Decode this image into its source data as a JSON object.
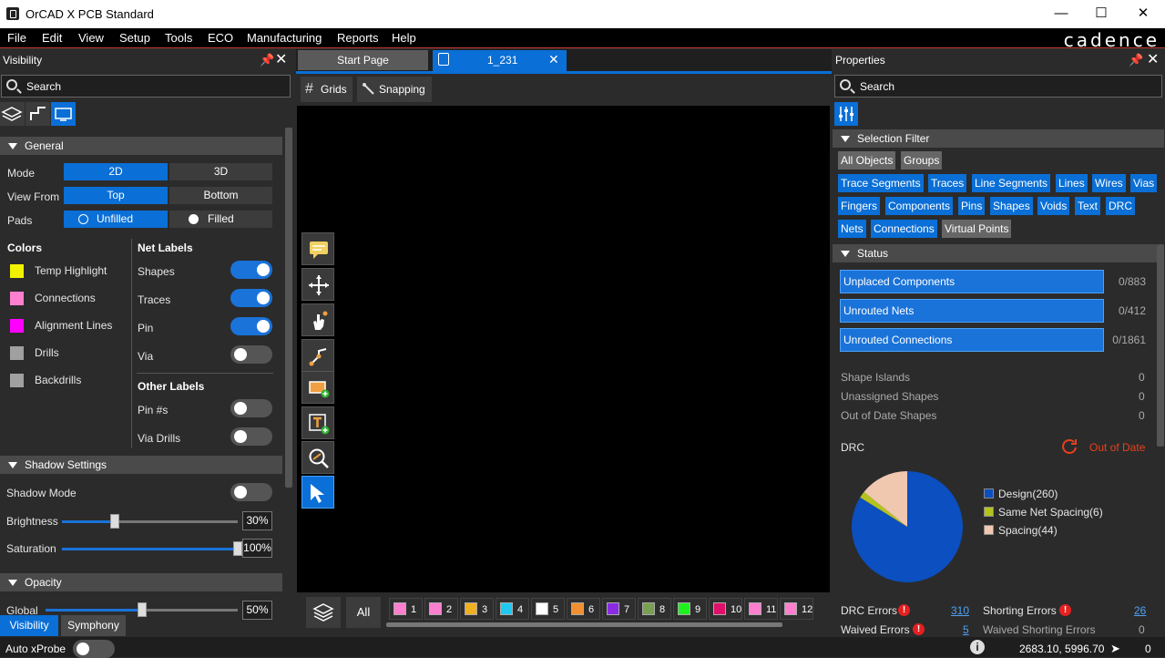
{
  "app": {
    "title": "OrCAD X PCB Standard",
    "brand": "cadence",
    "window_controls": [
      "—",
      "☐",
      "✕"
    ]
  },
  "menu": [
    "File",
    "Edit",
    "View",
    "Setup",
    "Tools",
    "ECO",
    "Manufacturing",
    "Reports",
    "Help"
  ],
  "visibility": {
    "title": "Visibility",
    "search_placeholder": "Search",
    "general": {
      "title": "General",
      "mode_label": "Mode",
      "mode_options": [
        "2D",
        "3D"
      ],
      "mode_selected": "2D",
      "view_from_label": "View From",
      "view_from_options": [
        "Top",
        "Bottom"
      ],
      "view_from_selected": "Top",
      "pads_label": "Pads",
      "pads_options": [
        "Unfilled",
        "Filled"
      ],
      "pads_selected": "Unfilled"
    },
    "colors": {
      "title": "Colors",
      "items": [
        {
          "label": "Temp Highlight",
          "color": "#f2f200"
        },
        {
          "label": "Connections",
          "color": "#ff7fcf"
        },
        {
          "label": "Alignment Lines",
          "color": "#ff00ff"
        },
        {
          "label": "Drills",
          "color": "#a0a0a0"
        },
        {
          "label": "Backdrills",
          "color": "#a0a0a0"
        }
      ]
    },
    "net_labels": {
      "title": "Net Labels",
      "items": [
        {
          "label": "Shapes",
          "on": true
        },
        {
          "label": "Traces",
          "on": true
        },
        {
          "label": "Pin",
          "on": true
        },
        {
          "label": "Via",
          "on": false
        }
      ]
    },
    "other_labels": {
      "title": "Other Labels",
      "items": [
        {
          "label": "Pin #s",
          "on": false
        },
        {
          "label": "Via Drills",
          "on": false
        }
      ]
    },
    "shadow": {
      "title": "Shadow Settings",
      "mode_label": "Shadow Mode",
      "mode_on": false,
      "brightness_label": "Brightness",
      "brightness": "30%",
      "brightness_value": 0.3,
      "saturation_label": "Saturation",
      "saturation": "100%",
      "saturation_value": 1.0
    },
    "opacity": {
      "title": "Opacity",
      "global_label": "Global",
      "global": "50%",
      "global_value": 0.5
    },
    "bottom_tabs": [
      "Visibility",
      "Symphony"
    ]
  },
  "editor": {
    "tabs": [
      "Start Page",
      "1_231"
    ],
    "active_tab": "1_231",
    "toolbar": {
      "grids": "Grids",
      "snapping": "Snapping"
    },
    "tools": [
      "comment-icon",
      "move-icon",
      "hand-icon",
      "route-icon",
      "add-shape-icon",
      "add-text-icon",
      "zoom-icon",
      "select-arrow-icon"
    ],
    "layers_all": "All",
    "layers": [
      {
        "num": "1",
        "color": "#ff7fcf"
      },
      {
        "num": "2",
        "color": "#ff7fcf"
      },
      {
        "num": "3",
        "color": "#f0b020"
      },
      {
        "num": "4",
        "color": "#20c8f0"
      },
      {
        "num": "5",
        "color": "#ffffff"
      },
      {
        "num": "6",
        "color": "#f09030"
      },
      {
        "num": "7",
        "color": "#8b2be2"
      },
      {
        "num": "8",
        "color": "#78a050"
      },
      {
        "num": "9",
        "color": "#20f020"
      },
      {
        "num": "10",
        "color": "#e0106a"
      },
      {
        "num": "11",
        "color": "#ff7fcf"
      },
      {
        "num": "12",
        "color": "#ff7fcf"
      }
    ]
  },
  "properties": {
    "title": "Properties",
    "search_placeholder": "Search",
    "selection_filter": {
      "title": "Selection Filter",
      "chips": [
        {
          "label": "All Objects",
          "active": false
        },
        {
          "label": "Groups",
          "active": false
        },
        {
          "label": "Trace Segments",
          "active": true
        },
        {
          "label": "Traces",
          "active": true
        },
        {
          "label": "Line Segments",
          "active": true
        },
        {
          "label": "Lines",
          "active": true
        },
        {
          "label": "Wires",
          "active": true
        },
        {
          "label": "Vias",
          "active": true
        },
        {
          "label": "Fingers",
          "active": true
        },
        {
          "label": "Components",
          "active": true
        },
        {
          "label": "Pins",
          "active": true
        },
        {
          "label": "Shapes",
          "active": true
        },
        {
          "label": "Voids",
          "active": true
        },
        {
          "label": "Text",
          "active": true
        },
        {
          "label": "DRC",
          "active": true
        },
        {
          "label": "Nets",
          "active": true
        },
        {
          "label": "Connections",
          "active": true
        },
        {
          "label": "Virtual Points",
          "active": false
        }
      ]
    },
    "status": {
      "title": "Status",
      "bars": [
        {
          "label": "Unplaced Components",
          "count": "0/883"
        },
        {
          "label": "Unrouted Nets",
          "count": "0/412"
        },
        {
          "label": "Unrouted Connections",
          "count": "0/1861"
        }
      ],
      "rows": [
        {
          "label": "Shape Islands",
          "value": "0"
        },
        {
          "label": "Unassigned Shapes",
          "value": "0"
        },
        {
          "label": "Out of Date Shapes",
          "value": "0"
        }
      ]
    },
    "drc": {
      "title": "DRC",
      "out_of_date": "Out of Date",
      "legend": [
        {
          "label": "Design(260)",
          "value": 260,
          "color": "#0b4fc0"
        },
        {
          "label": "Same Net Spacing(6)",
          "value": 6,
          "color": "#b5c21d"
        },
        {
          "label": "Spacing(44)",
          "value": 44,
          "color": "#f0c8b0"
        }
      ],
      "drc_errors_label": "DRC Errors",
      "drc_errors": "310",
      "waived_errors_label": "Waived Errors",
      "waived_errors": "5",
      "shorting_errors_label": "Shorting Errors",
      "shorting_errors": "26",
      "waived_shorting_label": "Waived Shorting Errors",
      "waived_shorting": "0"
    }
  },
  "statusbar": {
    "auto_xprobe": "Auto xProbe",
    "coords": "2683.10, 5996.70",
    "count": "0"
  }
}
